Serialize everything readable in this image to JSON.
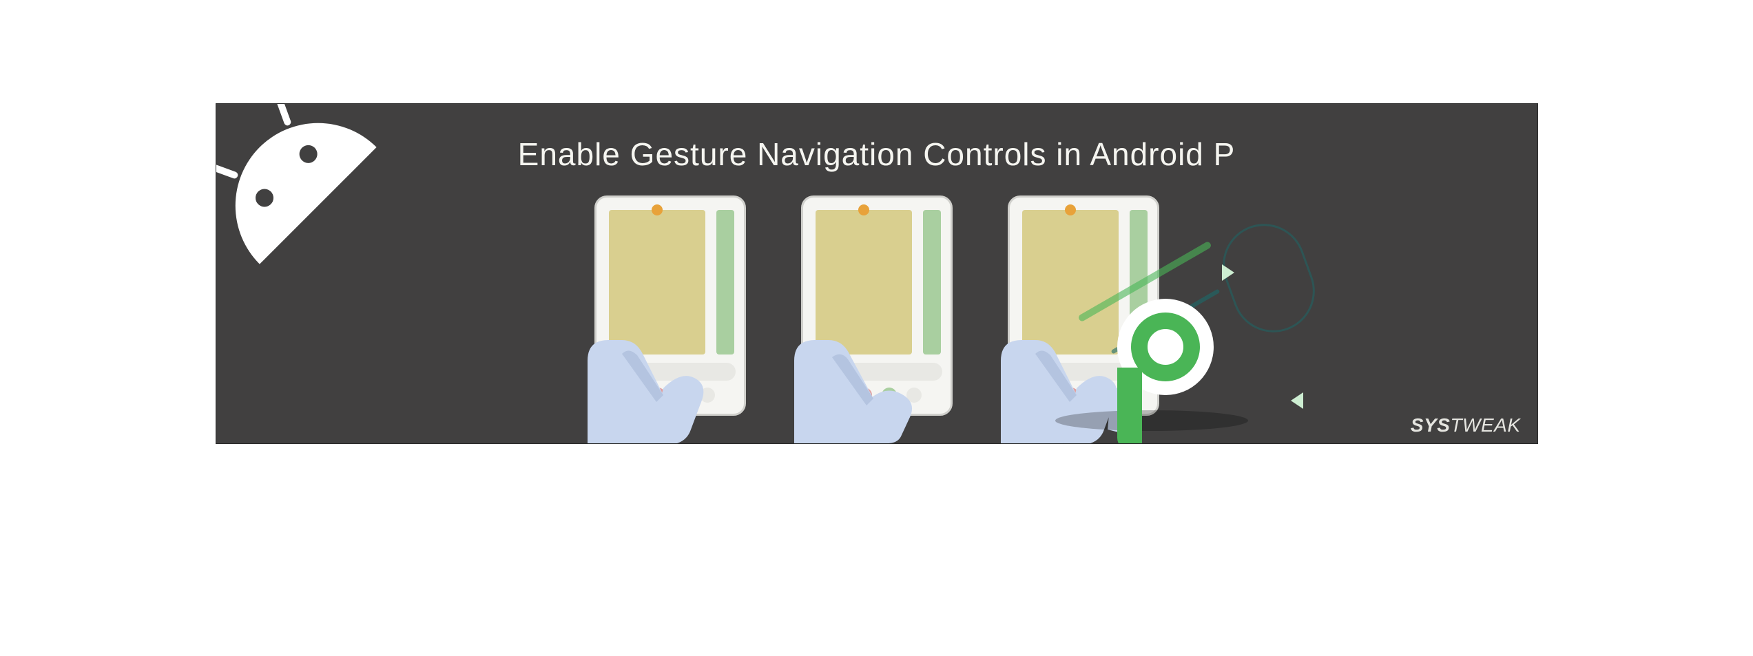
{
  "banner": {
    "title": "Enable Gesture Navigation Controls in Android P",
    "watermark_bold": "SYS",
    "watermark_light": "TWEAK"
  },
  "colors": {
    "background": "#414040",
    "accent_green": "#4ab556",
    "card_tan": "#d9cf8f",
    "hand_blue": "#c8d6ee"
  },
  "illustrations": {
    "phone_count": 3,
    "nav_dots": [
      "tan",
      "pink",
      "green",
      "grey"
    ]
  }
}
